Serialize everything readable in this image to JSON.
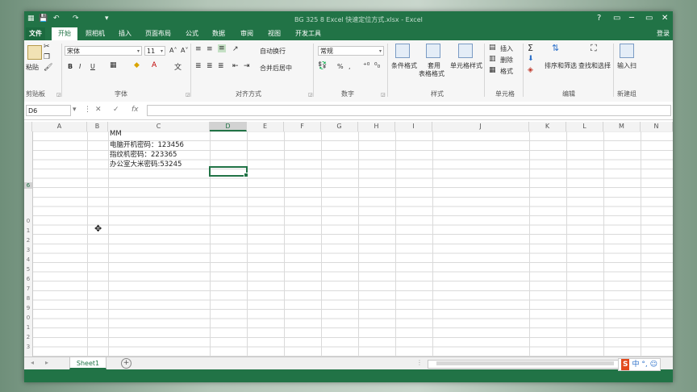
{
  "window": {
    "title": "BG 325 8 Excel 快速定位方式.xlsx - Excel",
    "quick_access": [
      "💾",
      "↶",
      "↷",
      "▾"
    ],
    "controls": [
      "?",
      "▭",
      "─",
      "▭",
      "✕"
    ]
  },
  "tabs": {
    "file": "文件",
    "items": [
      "开始",
      "照相机",
      "插入",
      "页面布局",
      "公式",
      "数据",
      "审阅",
      "视图",
      "开发工具"
    ],
    "login": "登录"
  },
  "ribbon": {
    "clipboard": {
      "paste": "粘贴",
      "label": "剪贴板"
    },
    "font": {
      "name": "宋体",
      "size": "11",
      "grow": "A˄",
      "shrink": "A˅",
      "bold": "B",
      "italic": "I",
      "underline": "U",
      "label": "字体"
    },
    "alignment": {
      "wrap": "自动换行",
      "merge": "合并后居中",
      "label": "对齐方式"
    },
    "number": {
      "format": "常规",
      "percent": "%",
      "comma": ",",
      "label": "数字"
    },
    "styles": {
      "conditional": "条件格式",
      "table_line1": "套用",
      "table_line2": "表格格式",
      "cell_styles": "单元格样式",
      "label": "样式"
    },
    "cells": {
      "insert": "插入",
      "delete": "删除",
      "format": "格式",
      "label": "单元格"
    },
    "editing": {
      "sigma": "Σ",
      "sort_filter": "排序和筛选",
      "find_select": "查找和选择",
      "label": "编辑"
    },
    "new_group": {
      "scan": "输入扫",
      "label": "新建组"
    }
  },
  "formula_bar": {
    "name_box": "D6",
    "fx": "fx",
    "cancel": "✕",
    "confirm": "✓",
    "value": ""
  },
  "columns": [
    "A",
    "B",
    "C",
    "D",
    "E",
    "F",
    "G",
    "H",
    "I",
    "J",
    "K",
    "L",
    "M",
    "N"
  ],
  "selected_column": "D",
  "rows": [
    "",
    "",
    "",
    "",
    "",
    "",
    "",
    "",
    "",
    "",
    "0",
    "1",
    "2",
    "3",
    "4",
    "5",
    "6",
    "7",
    "8",
    "9",
    "0",
    "1",
    "2",
    "3",
    "4"
  ],
  "cells": {
    "c2": "MM",
    "c3": "电脑开机密码：123456",
    "c4": "指纹机密码：223365",
    "c5": "办公室大米密码:53245"
  },
  "sheets": {
    "active": "Sheet1",
    "add": "⊕",
    "prev": "◂",
    "next": "▸"
  },
  "ime": {
    "logo": "S",
    "text": "中 °, ☺"
  }
}
